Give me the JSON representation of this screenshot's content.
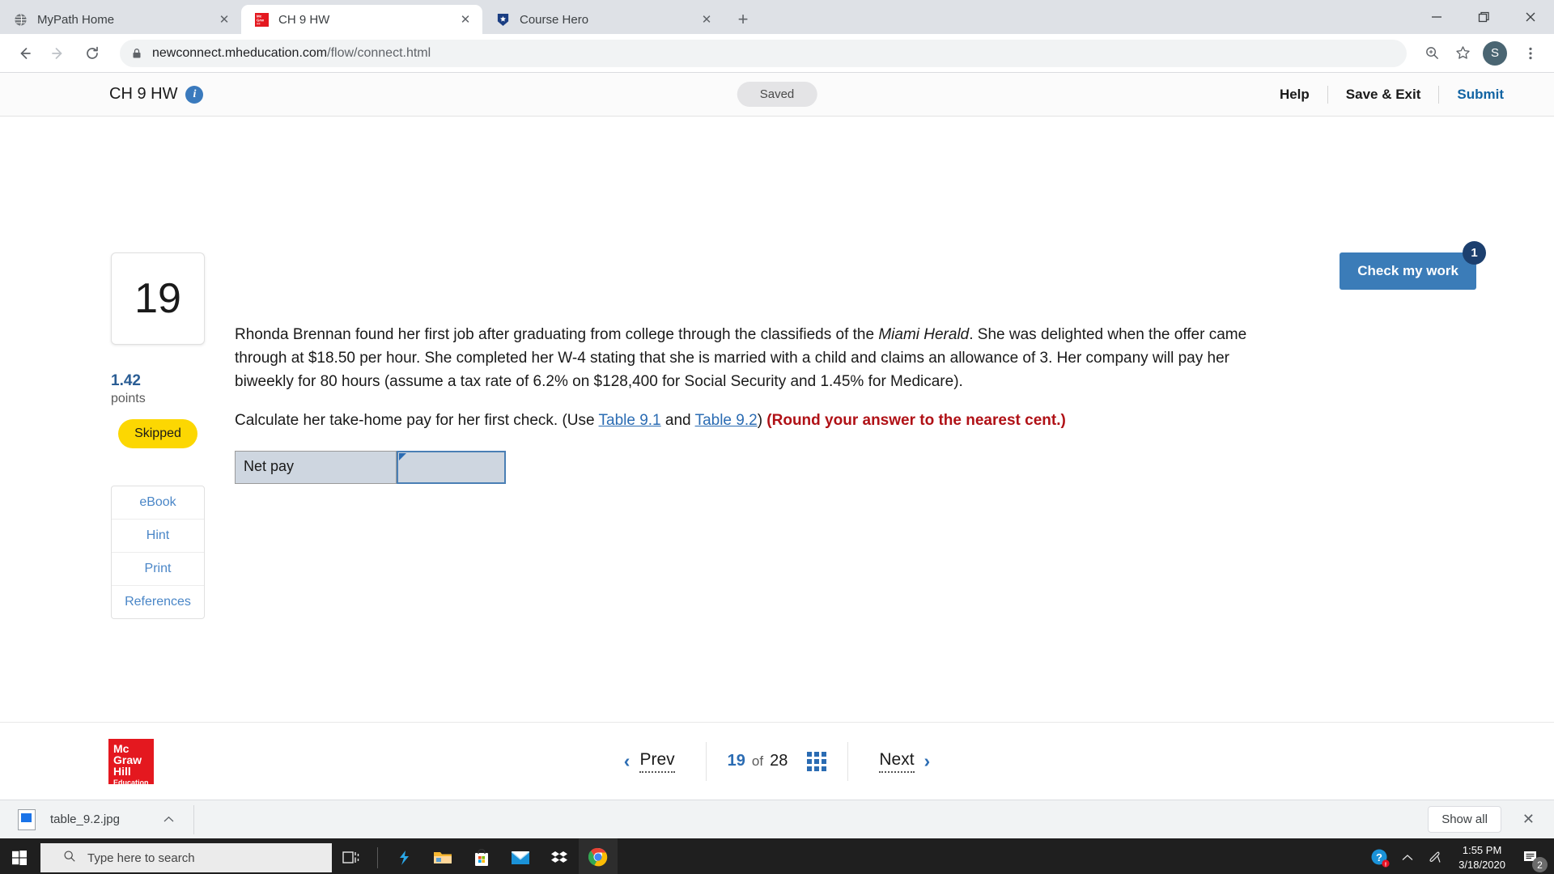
{
  "browser": {
    "tabs": [
      {
        "title": "MyPath Home",
        "favicon": "globe-icon",
        "active": false,
        "close_label": "✕"
      },
      {
        "title": "CH 9 HW",
        "favicon": "mcgraw-hill-icon",
        "active": true,
        "close_label": "✕"
      },
      {
        "title": "Course Hero",
        "favicon": "course-hero-icon",
        "active": false,
        "close_label": "✕"
      }
    ],
    "new_tab_label": "+",
    "window_controls": {
      "minimize": "—",
      "maximize": "❐",
      "close": "✕"
    },
    "toolbar": {
      "back": "←",
      "forward": "→",
      "reload": "⟳",
      "url_prefix": "newconnect.mheducation.com",
      "url_path": "/flow/connect.html",
      "zoom_icon": "zoom-icon",
      "bookmark_icon": "star-icon",
      "profile_initial": "S",
      "menu_icon": "three-dot-menu-icon"
    }
  },
  "app": {
    "title": "CH 9 HW",
    "info_icon_label": "i",
    "status_pill": "Saved",
    "help_label": "Help",
    "save_exit_label": "Save & Exit",
    "submit_label": "Submit"
  },
  "check_work": {
    "label": "Check my work",
    "badge": "1"
  },
  "question": {
    "number": "19",
    "points_value": "1.42",
    "points_label": "points",
    "status": "Skipped",
    "tools": [
      {
        "label": "eBook"
      },
      {
        "label": "Hint"
      },
      {
        "label": "Print"
      },
      {
        "label": "References"
      }
    ],
    "paragraph1_part1": "Rhonda Brennan found her first job after graduating from college through the classifieds of the ",
    "paragraph1_italic": "Miami Herald",
    "paragraph1_part2": ". She was delighted when the offer came through at $18.50 per hour. She completed her W-4 stating that she is married with a child and claims an allowance of 3. Her company will pay her biweekly for 80 hours (assume a tax rate of 6.2% on $128,400 for Social Security and 1.45% for Medicare).",
    "paragraph2_part1": "Calculate her take-home pay for her first check. (Use ",
    "link1": "Table 9.1",
    "paragraph2_mid": " and ",
    "link2": "Table 9.2",
    "paragraph2_part2": ") ",
    "round_note": "(Round your answer to the nearest cent.)",
    "answer_row_label": "Net pay",
    "answer_value": "",
    "answer_placeholder": ""
  },
  "bottom_nav": {
    "logo_line1": "Mc",
    "logo_line2": "Graw",
    "logo_line3": "Hill",
    "logo_line4": "Education",
    "prev_label": "Prev",
    "prev_arrow": "‹",
    "current_page": "19",
    "of_label": "of",
    "total_pages": "28",
    "grid_icon": "grid-view-icon",
    "next_label": "Next",
    "next_arrow": "›"
  },
  "downloads": {
    "file_name": "table_9.2.jpg",
    "file_icon": "image-file-icon",
    "chevron": "⌃",
    "show_all_label": "Show all",
    "close_label": "✕"
  },
  "taskbar": {
    "start_icon": "windows-start-icon",
    "search_placeholder": "Type here to search",
    "search_icon": "search-icon",
    "taskview_icon": "task-view-icon",
    "apps": [
      {
        "name": "snip-sketch-icon"
      },
      {
        "name": "file-explorer-icon"
      },
      {
        "name": "microsoft-store-icon"
      },
      {
        "name": "mail-icon"
      },
      {
        "name": "dropbox-icon"
      },
      {
        "name": "chrome-icon"
      }
    ],
    "tray": {
      "help_icon": "help-alert-icon",
      "chevron_icon": "show-hidden-icons-chevron",
      "pen_icon": "pen-workspace-icon",
      "time": "1:55 PM",
      "date": "3/18/2020",
      "notification_icon": "action-center-icon",
      "notification_count": "2"
    }
  },
  "colors": {
    "accent_blue": "#3b7cb8",
    "link_blue": "#2b6cb3",
    "warn_yellow": "#fcd702",
    "error_red": "#b01116",
    "brand_red": "#e4181f"
  }
}
